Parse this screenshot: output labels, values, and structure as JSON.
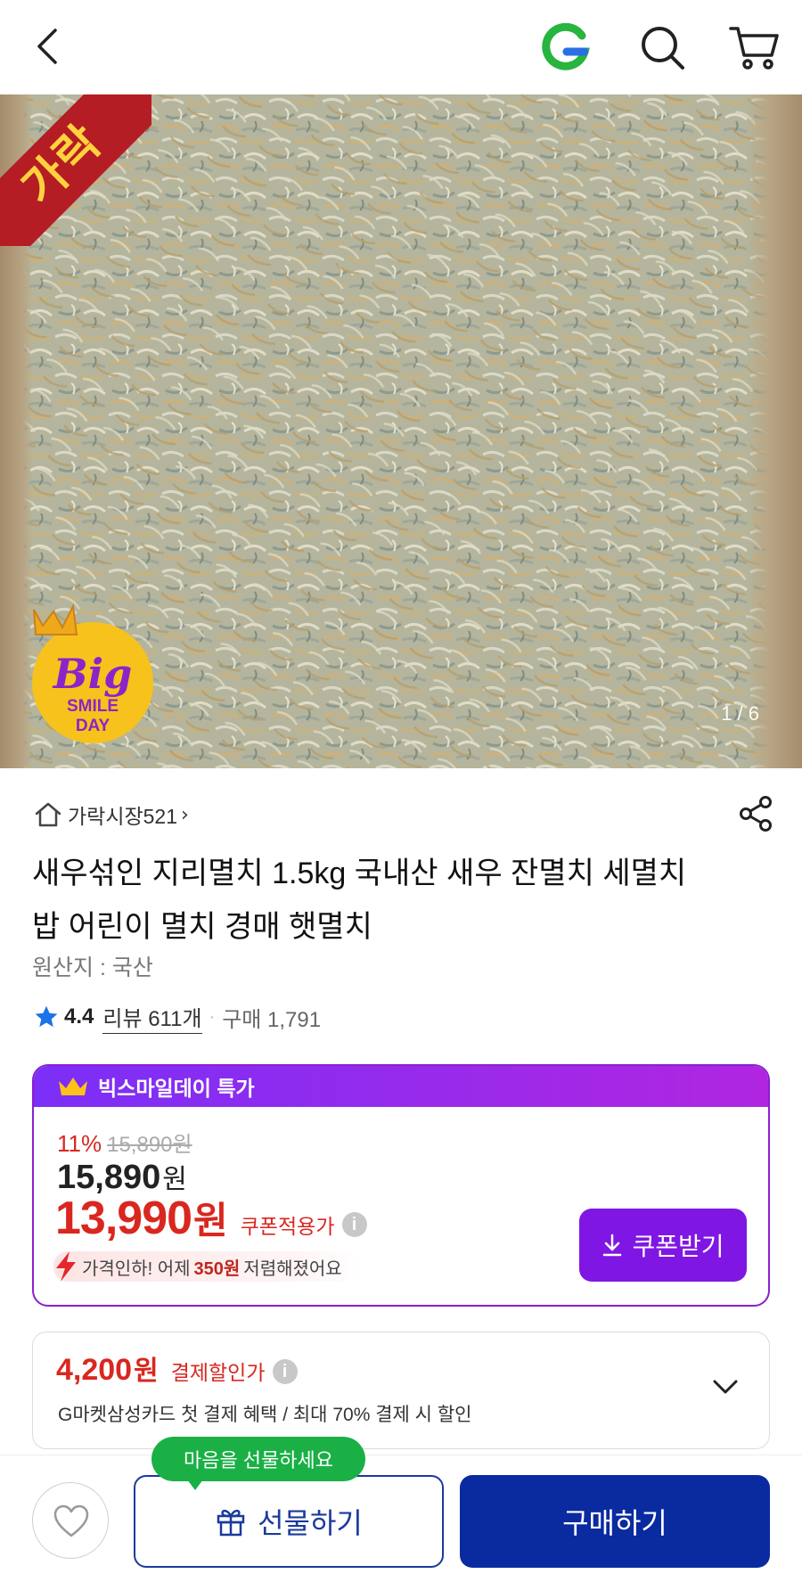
{
  "nav": {
    "back_icon": "chevron-left-icon",
    "g_logo": "G",
    "g_logo_color": "#27b43f",
    "search_icon": "search-icon",
    "cart_icon": "cart-icon"
  },
  "hero": {
    "corner_label": "가락",
    "badge_line1": "Big",
    "badge_line2": "SMILE",
    "badge_line3": "DAY",
    "counter": "1 / 6"
  },
  "store": {
    "name": "가락시장521",
    "chevron": "›"
  },
  "product": {
    "title": "새우섞인 지리멸치 1.5kg 국내산 새우 잔멸치 세멸치 밥 어린이 멸치 경매 햇멸치",
    "origin": "원산지 : 국산",
    "rating": "4.4",
    "review": "리뷰 611개",
    "dot": "·",
    "purchases": "구매 1,791"
  },
  "deal": {
    "header": "빅스마일데이 특가",
    "discount_pct": "11%",
    "original_price": "15,890원",
    "price": "15,890",
    "price_unit": "원",
    "coupon_price": "13,990",
    "coupon_unit": "원",
    "coupon_label": "쿠폰적용가",
    "info": "i",
    "drop_prefix": "가격인하! 어제",
    "drop_amount": "350원",
    "drop_suffix": "저렴해졌어요",
    "coupon_button": "쿠폰받기",
    "accent": "#8016e3",
    "price_red": "#d9271f"
  },
  "payment": {
    "amount": "4,200",
    "unit": "원",
    "label": "결제할인가",
    "info": "i",
    "description": "G마켓삼성카드 첫 결제 혜택 / 최대 70% 결제 시 할인"
  },
  "bottom": {
    "tooltip": "마음을 선물하세요",
    "gift": "선물하기",
    "buy": "구매하기",
    "buy_color": "#0a2aa0"
  }
}
